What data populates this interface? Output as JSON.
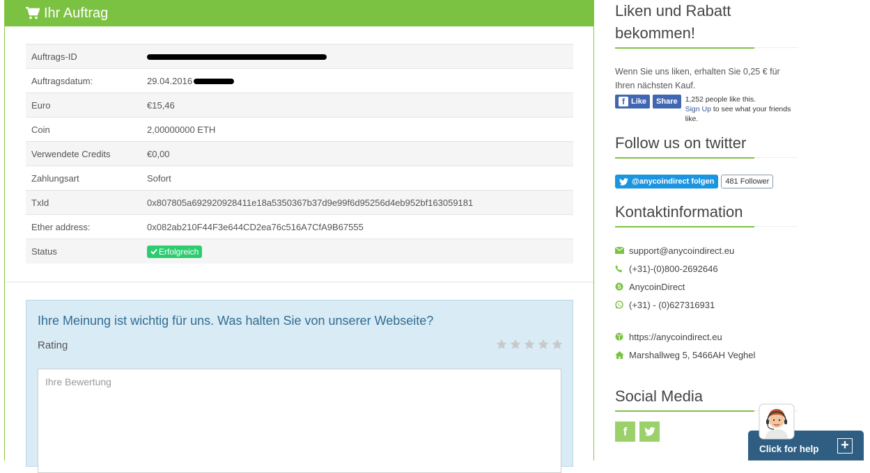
{
  "order": {
    "title": "Ihr Auftrag",
    "rows": [
      {
        "label": "Auftrags-ID",
        "value": ""
      },
      {
        "label": "Auftragsdatum:",
        "value": "29.04.2016"
      },
      {
        "label": "Euro",
        "value": "€15,46"
      },
      {
        "label": "Coin",
        "value": "2,00000000 ETH"
      },
      {
        "label": "Verwendete Credits",
        "value": "€0,00"
      },
      {
        "label": "Zahlungsart",
        "value": "Sofort"
      },
      {
        "label": "TxId",
        "value": "0x807805a692920928411e18a5350367b37d9e99f6d95256d4eb952bf163059181"
      },
      {
        "label": "Ether address:",
        "value": "0x082ab210F44F3e644CD2ea76c516A7CfA9B67555"
      },
      {
        "label": "Status",
        "value": "Erfolgreich"
      }
    ]
  },
  "feedback": {
    "title": "Ihre Meinung ist wichtig für uns. Was halten Sie von unserer Webseite?",
    "rating_label": "Rating",
    "textarea_placeholder": "Ihre Bewertung",
    "star_count": 5
  },
  "sidebar": {
    "like": {
      "heading": "Liken und Rabatt bekommen!",
      "text": "Wenn Sie uns liken, erhalten Sie 0,25 € für Ihren nächsten Kauf.",
      "like_label": "Like",
      "share_label": "Share",
      "count_text": "1,252 people like this.",
      "signup_link": "Sign Up",
      "signup_rest": "to see what your friends like."
    },
    "twitter": {
      "heading": "Follow us on twitter",
      "follow_label": "@anycoindirect folgen",
      "follower_count": "481 Follower"
    },
    "contact": {
      "heading": "Kontaktinformation",
      "email": "support@anycoindirect.eu",
      "phone": "(+31)-(0)800-2692646",
      "skype": "AnycoinDirect",
      "whatsapp": "(+31) - (0)627316931",
      "website": "https://anycoindirect.eu",
      "address": "Marshallweg 5, 5466AH Veghel"
    },
    "social": {
      "heading": "Social Media"
    }
  },
  "help_widget": {
    "label": "Click for help",
    "plus": "+"
  },
  "colors": {
    "brand_green": "#7cc242",
    "feedback_bg": "#d9ebf5",
    "help_bg": "#2f5e82",
    "status_green": "#2ecc71"
  }
}
